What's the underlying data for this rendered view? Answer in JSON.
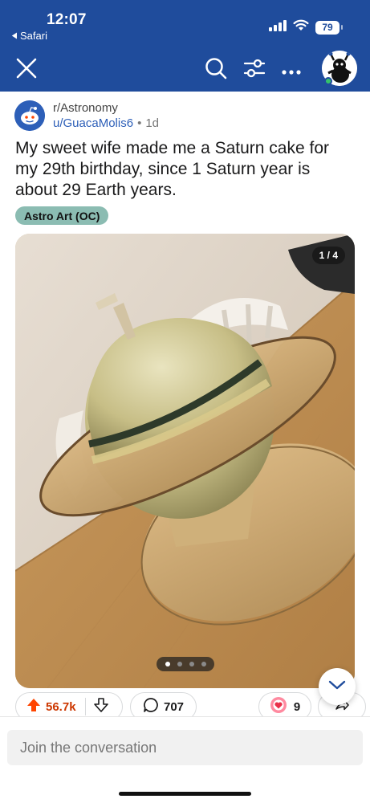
{
  "status_bar": {
    "time": "12:07",
    "back_label": "Safari",
    "battery": "79"
  },
  "header": {
    "icons": [
      "close-icon",
      "search-icon",
      "filter-icon",
      "more-icon",
      "profile-avatar"
    ]
  },
  "post": {
    "subreddit": "r/Astronomy",
    "author": "u/GuacaMolis6",
    "separator": "•",
    "age": "1d",
    "title": "My sweet wife made me a Saturn cake for my 29th birthday, since 1 Saturn year is about 29 Earth years.",
    "flair": "Astro Art (OC)",
    "image_counter": "1 / 4",
    "image_total": 4,
    "image_current": 1
  },
  "actions": {
    "upvotes": "56.7k",
    "comments": "707",
    "awards": "9"
  },
  "composer": {
    "placeholder": "Join the conversation"
  },
  "colors": {
    "header_bg": "#1f4c9c",
    "upvote": "#ff4500",
    "flair_bg": "#8bbcb2",
    "link": "#2d5fb8"
  }
}
